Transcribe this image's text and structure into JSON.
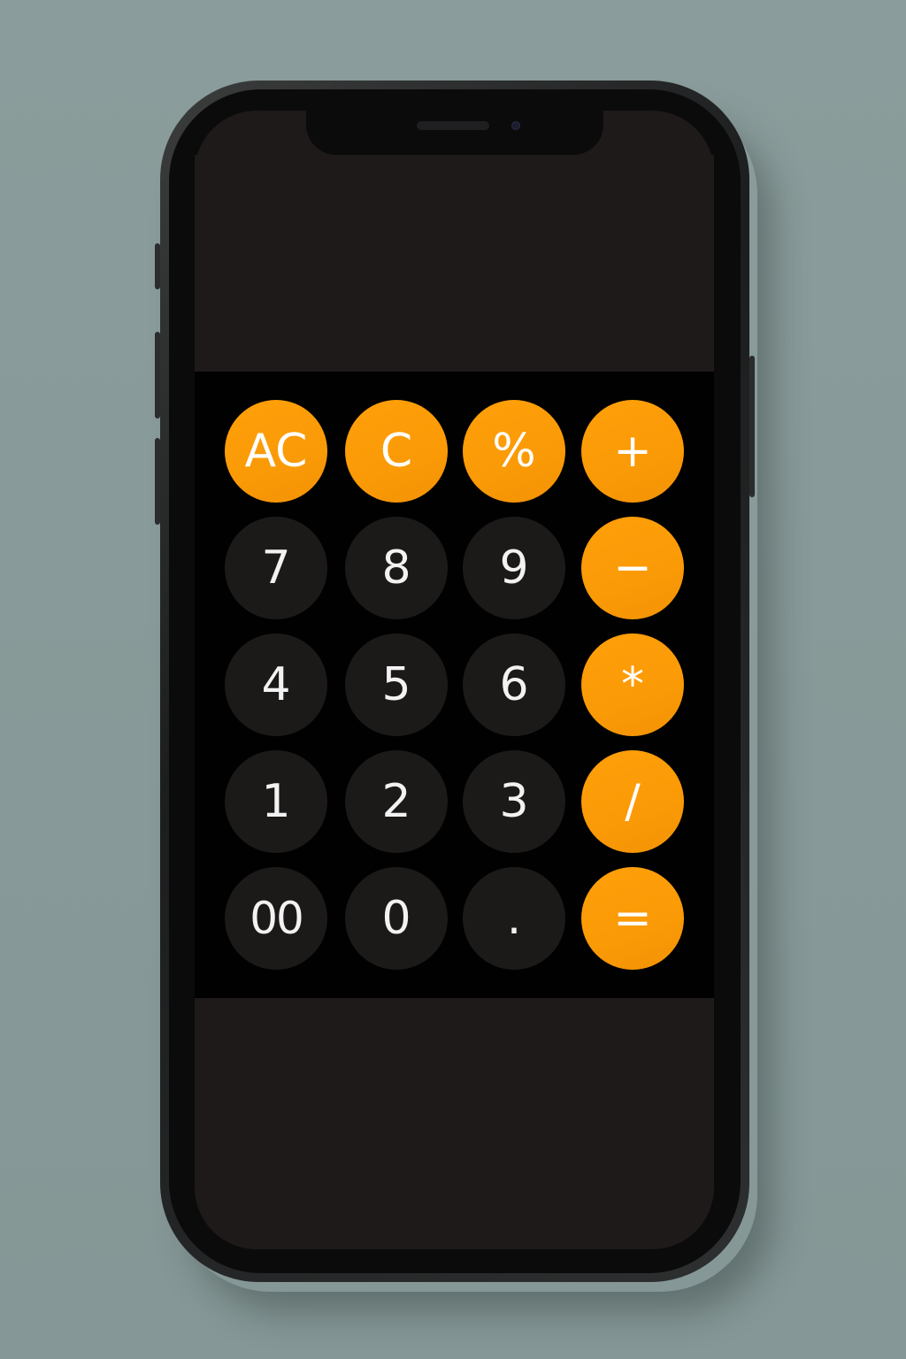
{
  "calculator": {
    "display_value": "",
    "keys": {
      "ac": "AC",
      "c": "C",
      "percent": "%",
      "plus": "+",
      "seven": "7",
      "eight": "8",
      "nine": "9",
      "minus": "−",
      "four": "4",
      "five": "5",
      "six": "6",
      "multiply": "*",
      "one": "1",
      "two": "2",
      "three": "3",
      "divide": "/",
      "double_zero": "00",
      "zero": "0",
      "decimal": ".",
      "equals": "="
    }
  },
  "colors": {
    "background": "#889a99",
    "operator_key": "#ff9f0a",
    "digit_key": "#1c1a19",
    "keypad_background": "#010101",
    "screen_background": "#1d1a19"
  }
}
